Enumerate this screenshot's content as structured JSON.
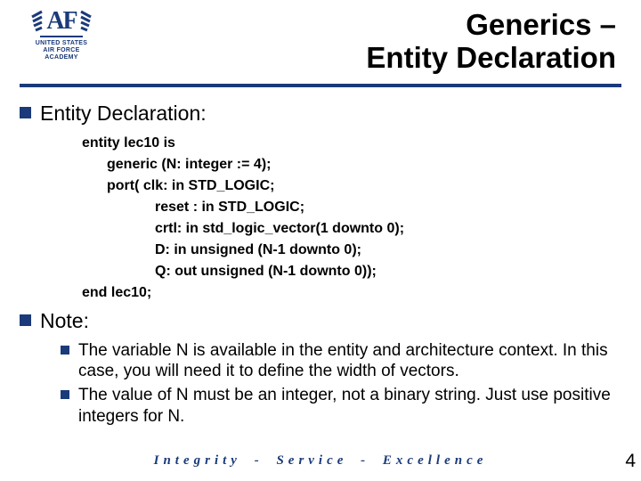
{
  "logo": {
    "letters": "AF",
    "line1": "UNITED STATES",
    "line2": "AIR FORCE",
    "line3": "ACADEMY"
  },
  "title": {
    "line1": "Generics –",
    "line2": "Entity Declaration"
  },
  "sections": {
    "entity_heading": "Entity Declaration:",
    "note_heading": "Note:"
  },
  "code": {
    "l1": "entity lec10 is",
    "l2": "generic (N: integer := 4);",
    "l3": "port(     clk: in  STD_LOGIC;",
    "l4": "reset : in  STD_LOGIC;",
    "l5": "crtl: in std_logic_vector(1 downto 0);",
    "l6": "D: in unsigned (N-1 downto 0);",
    "l7": "Q: out unsigned (N-1 downto 0));",
    "l8": "end lec10;"
  },
  "notes": {
    "n1": "The variable N is available in the entity and architecture context. In this case, you will need it to define the width of vectors.",
    "n2": "The value of N must be an integer, not a binary string. Just use positive integers for N."
  },
  "footer": "Integrity - Service - Excellence",
  "page": "4"
}
